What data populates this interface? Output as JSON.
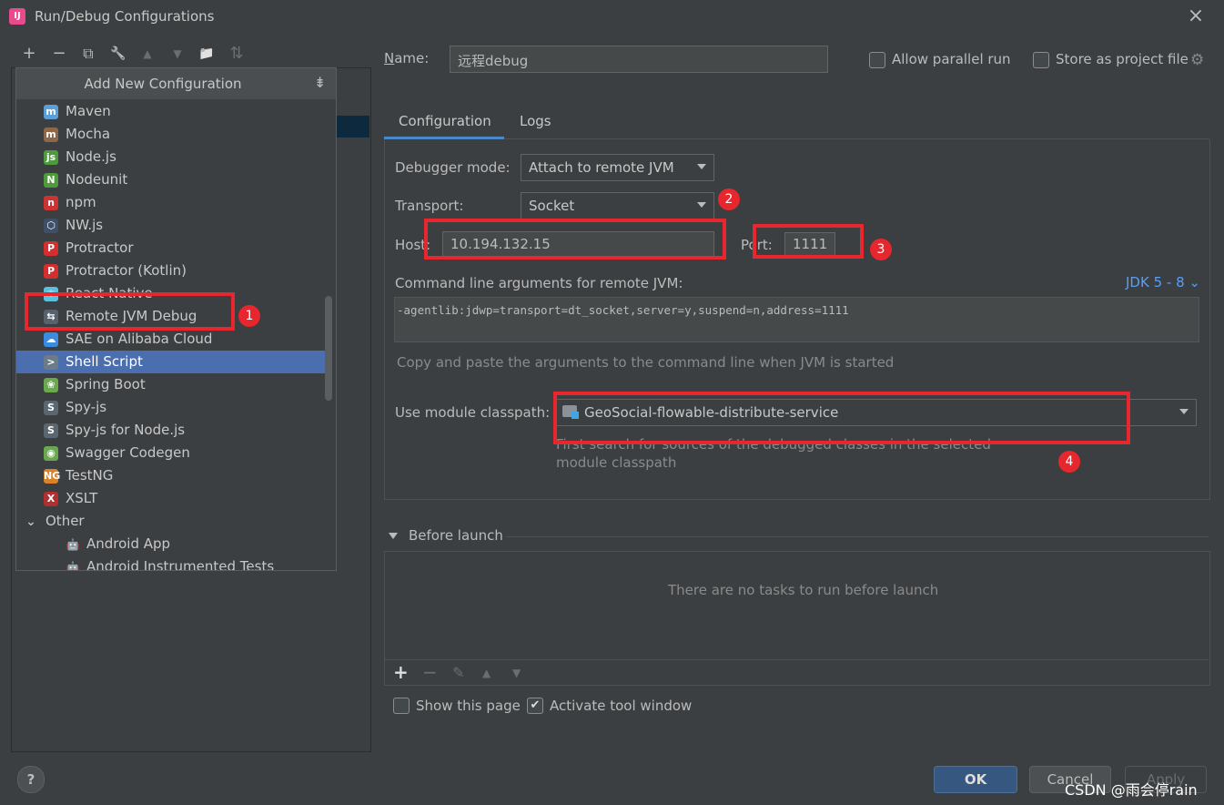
{
  "window": {
    "title": "Run/Debug Configurations",
    "close_icon": "×",
    "app_icon_text": "IJ"
  },
  "left_toolbar": {
    "icons": [
      "add-icon",
      "remove-icon",
      "copy-icon",
      "wrench-icon",
      "move-up-icon",
      "move-down-icon",
      "new-folder-icon",
      "sort-icon"
    ],
    "glyphs": {
      "add": "+",
      "remove": "−",
      "copy": "⧉",
      "wrench": "🔧",
      "up": "▲",
      "down": "▼",
      "folder": "📁",
      "sort": "⇅"
    }
  },
  "popup": {
    "title": "Add New Configuration",
    "items": [
      {
        "label": "Maven",
        "icon": "m",
        "color": "#5c9fd6"
      },
      {
        "label": "Mocha",
        "icon": "m",
        "color": "#8d6748"
      },
      {
        "label": "Node.js",
        "icon": "js",
        "color": "#4e9a3d"
      },
      {
        "label": "Nodeunit",
        "icon": "N",
        "color": "#4e9a3d"
      },
      {
        "label": "npm",
        "icon": "n",
        "color": "#c33"
      },
      {
        "label": "NW.js",
        "icon": "⬡",
        "color": "#3f4f69"
      },
      {
        "label": "Protractor",
        "icon": "P",
        "color": "#d32f2f"
      },
      {
        "label": "Protractor (Kotlin)",
        "icon": "P",
        "color": "#d32f2f"
      },
      {
        "label": "React Native",
        "icon": "⚛",
        "color": "#5bc0de"
      },
      {
        "label": "Remote JVM Debug",
        "icon": "⇆",
        "color": "#58626d"
      },
      {
        "label": "SAE on Alibaba Cloud",
        "icon": "☁",
        "color": "#3c8be0"
      },
      {
        "label": "Shell Script",
        "icon": ">",
        "color": "#6d7a88"
      },
      {
        "label": "Spring Boot",
        "icon": "❀",
        "color": "#6aa84f"
      },
      {
        "label": "Spy-js",
        "icon": "S",
        "color": "#5a6670"
      },
      {
        "label": "Spy-js for Node.js",
        "icon": "S",
        "color": "#5a6670"
      },
      {
        "label": "Swagger Codegen",
        "icon": "◉",
        "color": "#6aa84f"
      },
      {
        "label": "TestNG",
        "icon": "NG",
        "color": "#d9822b"
      },
      {
        "label": "XSLT",
        "icon": "X",
        "color": "#b03030"
      },
      {
        "label": "Other",
        "icon": "⌄",
        "color": ""
      },
      {
        "label": "Android App",
        "icon": "🤖",
        "color": "#3ddc84"
      },
      {
        "label": "Android Instrumented Tests",
        "icon": "🤖",
        "color": "#3ddc84"
      }
    ],
    "selected_label": "Shell Script"
  },
  "form": {
    "name_label": "Name:",
    "name_value": "远程debug",
    "allow_parallel": "Allow parallel run",
    "store_as_project": "Store as project file",
    "tabs": [
      "Configuration",
      "Logs"
    ],
    "debugger_mode_label": "Debugger mode:",
    "debugger_mode_value": "Attach to remote JVM",
    "transport_label": "Transport:",
    "transport_value": "Socket",
    "host_label": "Host:",
    "host_value": "10.194.132.15",
    "port_label": "Port:",
    "port_value": "1111",
    "cmd_label": "Command line arguments for remote JVM:",
    "jdk_link": "JDK 5 - 8 ⌄",
    "cmd_value": "-agentlib:jdwp=transport=dt_socket,server=y,suspend=n,address=1111",
    "cmd_hint": "Copy and paste the arguments to the command line when JVM is started",
    "module_label": "Use module classpath:",
    "module_value": "GeoSocial-flowable-distribute-service",
    "module_hint_1": "First search for sources of the debugged classes in the selected",
    "module_hint_2": "module classpath"
  },
  "before_launch": {
    "title": "Before launch",
    "empty": "There are no tasks to run before launch",
    "toolbar": {
      "add": "+",
      "remove": "−",
      "edit": "✎",
      "up": "▲",
      "down": "▼"
    }
  },
  "footer": {
    "show_this_page": "Show this page",
    "activate_tool_window": "Activate tool window",
    "ok": "OK",
    "cancel": "Cancel",
    "apply": "Apply",
    "help": "?",
    "watermark": "CSDN @雨会停rain"
  },
  "annotations": {
    "badge1": "1",
    "badge2": "2",
    "badge3": "3",
    "badge4": "4"
  },
  "colors": {
    "accent": "#4a88c7",
    "selection": "#4b6eaf",
    "annotation_red": "#e8262d",
    "link": "#589df6"
  }
}
